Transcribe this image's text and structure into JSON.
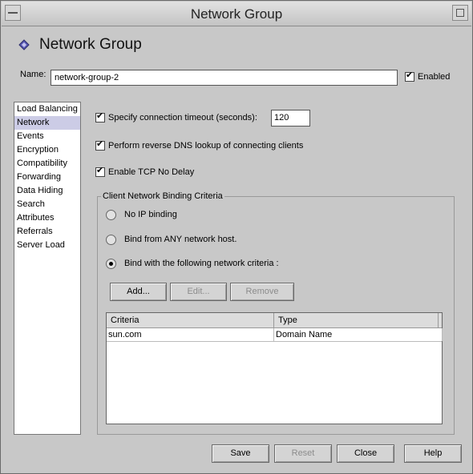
{
  "window": {
    "title": "Network Group"
  },
  "header": {
    "title": "Network Group"
  },
  "name": {
    "label": "Name:",
    "value": "network-group-2"
  },
  "enabled": {
    "label": "Enabled",
    "checked": true
  },
  "nav": {
    "items": [
      "Load Balancing",
      "Network",
      "Events",
      "Encryption",
      "Compatibility",
      "Forwarding",
      "Data Hiding",
      "Search",
      "Attributes",
      "Referrals",
      "Server Load"
    ],
    "selected": "Network"
  },
  "options": {
    "timeout_label": "Specify connection timeout (seconds):",
    "timeout_value": "120",
    "reverse_dns_label": "Perform reverse DNS lookup of connecting clients",
    "tcp_nodelay_label": "Enable TCP No Delay"
  },
  "binding": {
    "title": "Client Network Binding Criteria",
    "radio_none": "No IP binding",
    "radio_any": "Bind from ANY network host.",
    "radio_criteria": "Bind with the following network criteria :",
    "selected": "criteria",
    "add_label": "Add...",
    "edit_label": "Edit...",
    "remove_label": "Remove",
    "columns": [
      "Criteria",
      "Type"
    ],
    "rows": [
      [
        "sun.com",
        "Domain Name"
      ]
    ]
  },
  "footer": {
    "save": "Save",
    "reset": "Reset",
    "close": "Close",
    "help": "Help"
  },
  "colors": {
    "background": "#c8c8c8",
    "selection": "#cccce6",
    "header_icon": "#5a5ab4"
  }
}
